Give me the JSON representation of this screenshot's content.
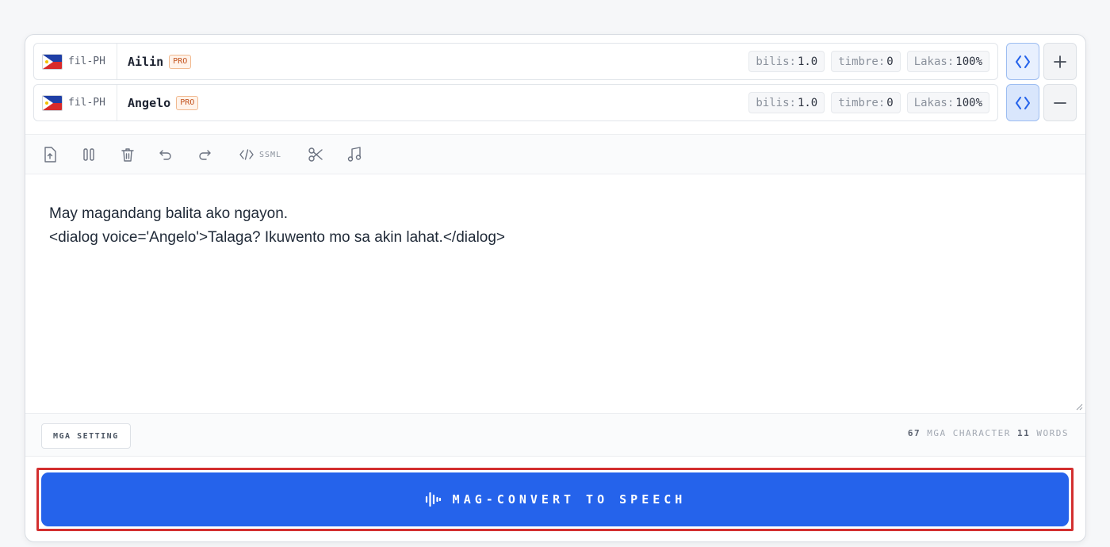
{
  "voices": [
    {
      "locale": "fil-PH",
      "name": "Ailin",
      "badge": "PRO",
      "params": [
        {
          "label": "bilis:",
          "value": "1.0"
        },
        {
          "label": "timbre:",
          "value": "0"
        },
        {
          "label": "Lakas:",
          "value": "100%"
        }
      ],
      "action_icon": "plus-icon"
    },
    {
      "locale": "fil-PH",
      "name": "Angelo",
      "badge": "PRO",
      "params": [
        {
          "label": "bilis:",
          "value": "1.0"
        },
        {
          "label": "timbre:",
          "value": "0"
        },
        {
          "label": "Lakas:",
          "value": "100%"
        }
      ],
      "action_icon": "minus-icon"
    }
  ],
  "toolbar": {
    "tools": [
      "upload-file-icon",
      "pause-icon",
      "trash-icon",
      "undo-icon",
      "redo-icon",
      "ssml-code-icon",
      "scissors-icon",
      "music-note-icon"
    ],
    "ssml_label": "SSML"
  },
  "editor": {
    "lines": [
      "May magandang balita ako ngayon.",
      "<dialog voice='Angelo'>Talaga? Ikuwento mo sa akin lahat.</dialog>"
    ]
  },
  "footer": {
    "settings_label": "MGA SETTING",
    "char_count": "67",
    "char_label": "MGA CHARACTER",
    "word_count": "11",
    "word_label": "WORDS"
  },
  "convert": {
    "label": "MAG-CONVERT TO SPEECH",
    "icon": "audio-wave-icon"
  },
  "colors": {
    "accent": "#2563eb",
    "highlight": "#d32f2f",
    "pro_badge": "#c2511c"
  }
}
